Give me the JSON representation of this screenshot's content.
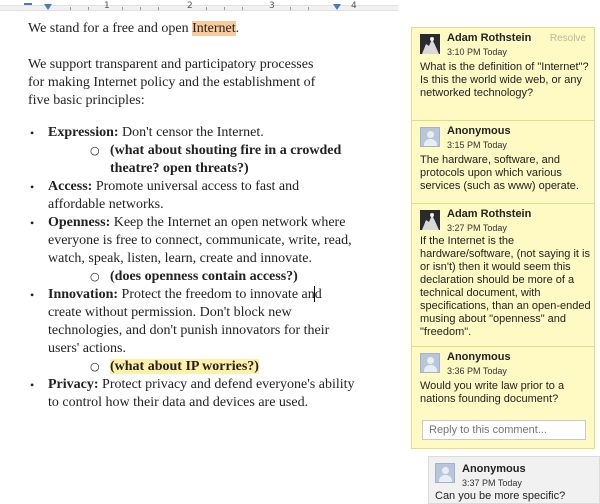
{
  "ruler": {
    "n1": "1",
    "n2": "2",
    "n3": "3",
    "n4": "4"
  },
  "doc": {
    "p1_before": "We stand for a free and open ",
    "p1_highlight": "Internet",
    "p1_after": ".",
    "p2": "We support transparent and participatory processes for making Internet policy and the establishment of five basic principles:",
    "items": [
      {
        "bold": "Expression:",
        "text": " Don't censor the Internet."
      },
      {
        "sub": "(what about shouting fire in a crowded theatre? open threats?)"
      },
      {
        "bold": "Access:",
        "text": " Promote universal access to fast and affordable networks."
      },
      {
        "bold": "Openness:",
        "text": " Keep the Internet an open network where everyone is free to connect, communicate, write, read, watch, speak, listen, learn, create and innovate."
      },
      {
        "sub": "(does openness contain access?)"
      },
      {
        "bold": "Innovation:",
        "text": " Protect the freedom to innovate and create without permission. Don't block new technologies, and don't punish innovators for their users' actions."
      },
      {
        "sub": "(what about IP worries?)"
      },
      {
        "bold": "Privacy:",
        "text": " Protect privacy and defend everyone's ability to control how their data and devices are used."
      }
    ],
    "bullet": "•",
    "sub_bullet": "○"
  },
  "comments": {
    "resolve": "Resolve",
    "list": [
      {
        "author": "Adam Rothstein",
        "time": "3:10 PM Today",
        "text": "What is the definition of \"Internet\"? Is this the world wide web, or any networked technology?"
      },
      {
        "author": "Anonymous",
        "time": "3:15 PM Today",
        "text": "The hardware, software, and protocols upon which various services (such as www) operate."
      },
      {
        "author": "Adam Rothstein",
        "time": "3:27 PM Today",
        "text": "If the Internet is the hardware/software, (not saying it is or isn't) then it would seem this declaration should be more of a technical document, with specifications, than an open-ended musing about \"openness\" and \"freedom\"."
      },
      {
        "author": "Anonymous",
        "time": "3:36 PM Today",
        "text": "Would you write law prior to a nations founding document?"
      }
    ],
    "reply_placeholder": "Reply to this comment..."
  },
  "thread2": {
    "author": "Anonymous",
    "time": "3:37 PM Today",
    "text": "Can you be more specific?"
  }
}
